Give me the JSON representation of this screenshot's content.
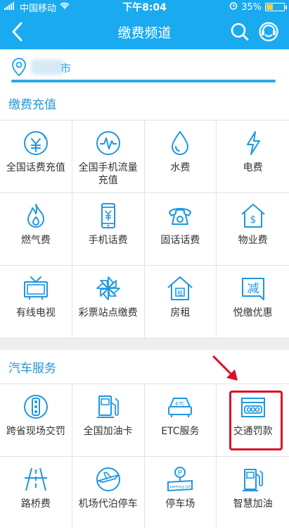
{
  "status_bar": {
    "carrier": "中国移动",
    "time": "下午8:04",
    "battery": "35%",
    "battery_level": 0.35
  },
  "header": {
    "title": "缴费频道",
    "back_icon": "chevron-left-icon",
    "search_icon": "search-icon",
    "service_icon": "customer-service-icon"
  },
  "location": {
    "city_visible": "市"
  },
  "colors": {
    "brand": "#1aaaf0",
    "accent": "#2fa7ea",
    "highlight": "#d8102b"
  },
  "sections": [
    {
      "title": "缴费充值",
      "items": [
        {
          "label": "全国话费充值",
          "icon": "phone-recharge-icon"
        },
        {
          "label": "全国手机流量充值",
          "icon": "data-flow-icon"
        },
        {
          "label": "水费",
          "icon": "water-drop-icon"
        },
        {
          "label": "电费",
          "icon": "lightning-icon"
        },
        {
          "label": "燃气费",
          "icon": "flame-icon"
        },
        {
          "label": "手机话费",
          "icon": "mobile-phone-icon"
        },
        {
          "label": "固话话费",
          "icon": "telephone-icon"
        },
        {
          "label": "物业费",
          "icon": "house-dollar-icon"
        },
        {
          "label": "有线电视",
          "icon": "tv-icon"
        },
        {
          "label": "彩票站点缴费",
          "icon": "pinwheel-icon"
        },
        {
          "label": "房租",
          "icon": "rent-house-icon"
        },
        {
          "label": "悦缴优惠",
          "icon": "discount-icon"
        }
      ]
    },
    {
      "title": "汽车服务",
      "items": [
        {
          "label": "跨省现场交罚",
          "icon": "traffic-light-icon"
        },
        {
          "label": "全国加油卡",
          "icon": "fuel-pump-icon"
        },
        {
          "label": "ETC服务",
          "icon": "etc-icon"
        },
        {
          "label": "交通罚款",
          "icon": "traffic-fine-icon"
        },
        {
          "label": "路桥费",
          "icon": "road-icon"
        },
        {
          "label": "机场代泊停车",
          "icon": "airport-parking-icon"
        },
        {
          "label": "停车场",
          "icon": "parking-icon"
        },
        {
          "label": "智慧加油",
          "icon": "smart-fuel-icon"
        }
      ]
    }
  ]
}
